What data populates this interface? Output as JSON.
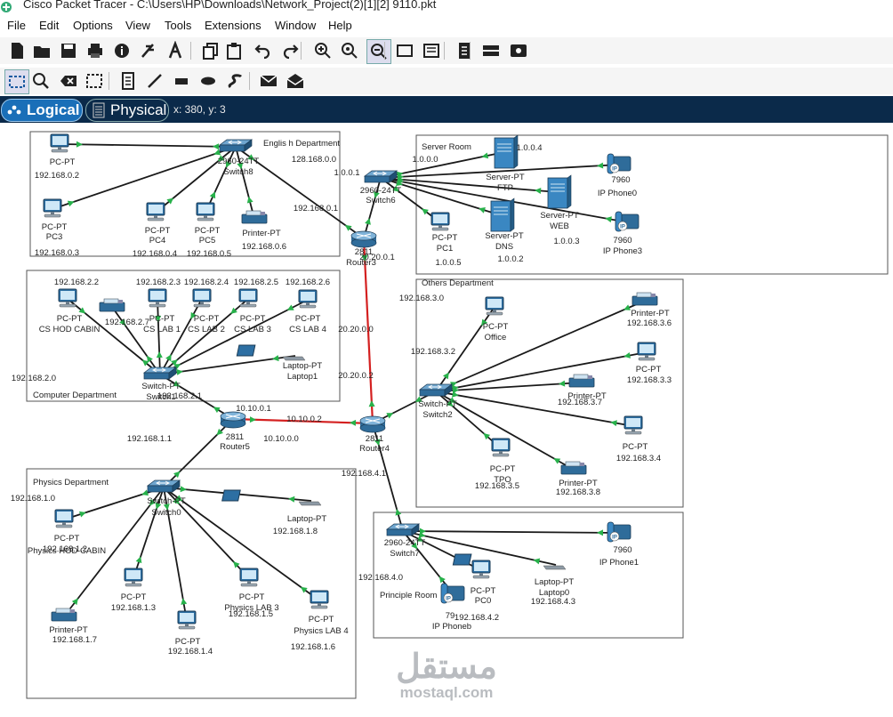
{
  "window": {
    "title": "Cisco Packet Tracer - C:\\Users\\HP\\Downloads\\Network_Project(2)[1][2] 9110.pkt"
  },
  "menu": [
    "File",
    "Edit",
    "Options",
    "View",
    "Tools",
    "Extensions",
    "Window",
    "Help"
  ],
  "toolbar_main": [
    "new-file-icon",
    "open-folder-icon",
    "save-icon",
    "print-icon",
    "info-icon",
    "activity-wizard-icon",
    "network-info-icon",
    "copy-icon",
    "paste-icon",
    "undo-icon",
    "redo-icon",
    "zoom-in-icon",
    "zoom-reset-icon",
    "zoom-out-icon",
    "drawing-palette-icon",
    "custom-device-icon",
    "view-notes-icon",
    "cluster-icon",
    "physical-workspace-icon"
  ],
  "toolbar_common": [
    "select-icon",
    "inspect-icon",
    "delete-icon",
    "resize-shape-icon",
    "place-note-icon",
    "line-icon",
    "rectangle-icon",
    "ellipse-icon",
    "freeform-icon",
    "simple-pdu-icon",
    "complex-pdu-icon"
  ],
  "mode": {
    "logical": "Logical",
    "physical": "Physical",
    "coords": "x: 380, y: 3"
  },
  "colors": {
    "link_black": "#1a1a1a",
    "link_red": "#d42020",
    "port_green": "#27b14a",
    "mode_bar": "#0b2a4a",
    "logical_active": "#1a6fb8"
  },
  "areas": [
    {
      "id": "english",
      "title": "Englis h Department"
    },
    {
      "id": "server",
      "title": "Server Room"
    },
    {
      "id": "computer",
      "title": "Computer Department"
    },
    {
      "id": "others",
      "title": "Others Department"
    },
    {
      "id": "physics",
      "title": "Physics Department"
    },
    {
      "id": "principal",
      "title": "Principle Room"
    }
  ],
  "devices": [
    {
      "id": "pc02",
      "type": "pc",
      "model": "PC-PT",
      "name": "",
      "ip": "192.168.0.2"
    },
    {
      "id": "pc3",
      "type": "pc",
      "model": "PC-PT",
      "name": "PC3",
      "ip": "192.168.0.3"
    },
    {
      "id": "pc4",
      "type": "pc",
      "model": "PC-PT",
      "name": "PC4",
      "ip": "192.168.0.4"
    },
    {
      "id": "pc5",
      "type": "pc",
      "model": "PC-PT",
      "name": "PC5",
      "ip": "192.168.0.5"
    },
    {
      "id": "prn06",
      "type": "printer",
      "model": "Printer-PT",
      "name": "",
      "ip": "192.168.0.6"
    },
    {
      "id": "sw8",
      "type": "switch",
      "model": "2960-24TT",
      "name": "Switch8",
      "ip": ""
    },
    {
      "id": "r3",
      "type": "router",
      "model": "2811",
      "name": "Router3",
      "ip": ""
    },
    {
      "id": "sw6",
      "type": "switch",
      "model": "2960-24TT",
      "name": "Switch6",
      "ip": ""
    },
    {
      "id": "ftp",
      "type": "server",
      "model": "Server-PT",
      "name": "FTP",
      "ip": ""
    },
    {
      "id": "web",
      "type": "server",
      "model": "Server-PT",
      "name": "WEB",
      "ip": "1.0.0.3"
    },
    {
      "id": "dns",
      "type": "server",
      "model": "Server-PT",
      "name": "DNS",
      "ip": "1.0.0.2"
    },
    {
      "id": "pc1",
      "type": "pc",
      "model": "PC-PT",
      "name": "PC1",
      "ip": "1.0.0.5"
    },
    {
      "id": "ph0",
      "type": "phone",
      "model": "7960",
      "name": "IP Phone0",
      "ip": ""
    },
    {
      "id": "ph3",
      "type": "phone",
      "model": "7960",
      "name": "IP Phone3",
      "ip": ""
    },
    {
      "id": "sw1",
      "type": "switch",
      "model": "Switch-PT",
      "name": "Switch1",
      "ip": ""
    },
    {
      "id": "cshod",
      "type": "pc",
      "model": "PC-PT",
      "name": "CS HOD CABIN",
      "ip": "192.168.2.2"
    },
    {
      "id": "prn27",
      "type": "printer",
      "model": "",
      "name": "",
      "ip": "192.168.2.7"
    },
    {
      "id": "cslab1",
      "type": "pc",
      "model": "PC-PT",
      "name": "CS LAB 1",
      "ip": "192.168.2.3"
    },
    {
      "id": "cslab2",
      "type": "pc",
      "model": "PC-PT",
      "name": "CS LAB 2",
      "ip": "192.168.2.4"
    },
    {
      "id": "cslab3",
      "type": "pc",
      "model": "PC-PT",
      "name": "CS LAB 3",
      "ip": "192.168.2.5"
    },
    {
      "id": "cslab4",
      "type": "pc",
      "model": "PC-PT",
      "name": "CS LAB 4",
      "ip": "192.168.2.6"
    },
    {
      "id": "lap1",
      "type": "laptop",
      "model": "Laptop-PT",
      "name": "Laptop1",
      "ip": ""
    },
    {
      "id": "r5",
      "type": "router",
      "model": "2811",
      "name": "Router5",
      "ip": ""
    },
    {
      "id": "r4",
      "type": "router",
      "model": "2811",
      "name": "Router4",
      "ip": ""
    },
    {
      "id": "sw2",
      "type": "switch",
      "model": "Switch-PT",
      "name": "Switch2",
      "ip": ""
    },
    {
      "id": "office",
      "type": "pc",
      "model": "PC-PT",
      "name": "Office",
      "ip": ""
    },
    {
      "id": "prn36",
      "type": "printer",
      "model": "Printer-PT",
      "name": "",
      "ip": "192.168.3.6"
    },
    {
      "id": "pc33",
      "type": "pc",
      "model": "PC-PT",
      "name": "",
      "ip": "192.168.3.3"
    },
    {
      "id": "prn37",
      "type": "printer",
      "model": "Printer-PT",
      "name": "",
      "ip": "192.168.3.7"
    },
    {
      "id": "pc34",
      "type": "pc",
      "model": "PC-PT",
      "name": "",
      "ip": "192.168.3.4"
    },
    {
      "id": "tpo",
      "type": "pc",
      "model": "PC-PT",
      "name": "TPO",
      "ip": "192.168.3.5"
    },
    {
      "id": "prn38",
      "type": "printer",
      "model": "Printer-PT",
      "name": "",
      "ip": "192.168.3.8"
    },
    {
      "id": "sw0",
      "type": "switch",
      "model": "Switch-PT",
      "name": "Switch0",
      "ip": ""
    },
    {
      "id": "phycab",
      "type": "pc",
      "model": "PC-PT",
      "name": "Physics HOD CABIN",
      "ip": "192.168.1.2"
    },
    {
      "id": "lap18",
      "type": "laptop",
      "model": "Laptop-PT",
      "name": "",
      "ip": "192.168.1.8"
    },
    {
      "id": "prn17",
      "type": "printer",
      "model": "Printer-PT",
      "name": "",
      "ip": "192.168.1.7"
    },
    {
      "id": "pc13",
      "type": "pc",
      "model": "PC-PT",
      "name": "",
      "ip": "192.168.1.3"
    },
    {
      "id": "pc14",
      "type": "pc",
      "model": "PC-PT",
      "name": "",
      "ip": "192.168.1.4"
    },
    {
      "id": "phylab3",
      "type": "pc",
      "model": "PC-PT",
      "name": "Physics LAB 3",
      "ip": "192.168.1.5"
    },
    {
      "id": "phylab4",
      "type": "pc",
      "model": "PC-PT",
      "name": "Physics LAB 4",
      "ip": "192.168.1.6"
    },
    {
      "id": "sw7",
      "type": "switch",
      "model": "2960-24TT",
      "name": "Switch7",
      "ip": ""
    },
    {
      "id": "ph1",
      "type": "phone",
      "model": "7960",
      "name": "IP Phone1",
      "ip": ""
    },
    {
      "id": "pc0",
      "type": "pc",
      "model": "PC-PT",
      "name": "PC0",
      "ip": "192.168.4.2"
    },
    {
      "id": "lap0",
      "type": "laptop",
      "model": "Laptop-PT",
      "name": "Laptop0",
      "ip": "192.168.4.3"
    },
    {
      "id": "phb",
      "type": "phone",
      "model": "79",
      "name": "IP Phoneb",
      "ip": ""
    }
  ],
  "notes": [
    "128.168.0.0",
    "192.168.0.1",
    "1.0.0.0",
    "1.0.0.1",
    "1.0.0.4",
    "20.20.0.1",
    "20.20.0.0",
    "20.20.0.2",
    "192.168.3.0",
    "192.168.3.2",
    "192.168.2.0",
    "192.168.2.1",
    "10.10.0.1",
    "10.10.0.2",
    "10.10.0.0",
    "192.168.1.1",
    "192.168.1.0",
    "192.168.4.1",
    "192.168.4.0"
  ],
  "watermark": {
    "arabic": "مستقل",
    "latin": "mostaql.com"
  }
}
